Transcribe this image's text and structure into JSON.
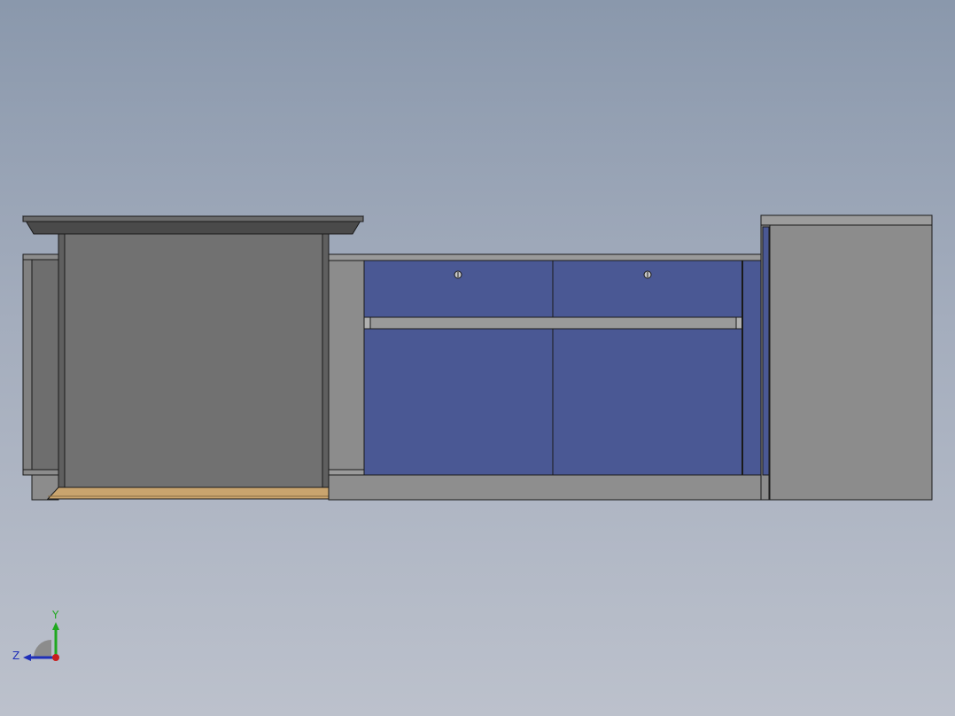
{
  "viewport": {
    "background_top": "#8a98ac",
    "background_bottom": "#bcc1cc"
  },
  "model": {
    "colors": {
      "steel_dark": "#5a5a5a",
      "steel_mid": "#6e6e6e",
      "steel_light": "#8c8c8c",
      "steel_pale": "#999999",
      "top_slab": "#4a4a4a",
      "top_slab_edge": "#6a6a6a",
      "door_blue": "#4a5894",
      "door_blue_dark": "#3a4680",
      "wood_base": "#c9a46e",
      "outline": "#1a1a1a"
    },
    "parts": {
      "left_cabinet": "left-cabinet",
      "center_cabinet": "center-cabinet",
      "right_cabinet": "right-cabinet"
    }
  },
  "triad": {
    "y_label": "Y",
    "z_label": "Z",
    "y_color": "#1fa81f",
    "z_color": "#1f2fb8",
    "x_color": "#c81e1e"
  }
}
